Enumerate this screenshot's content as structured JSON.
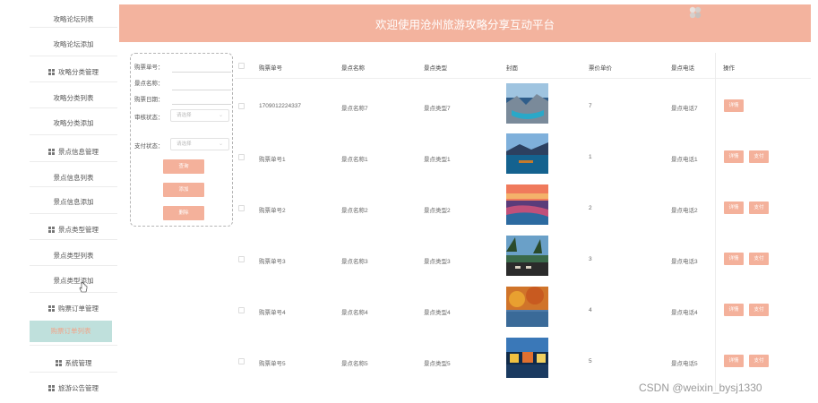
{
  "header": {
    "title": "欢迎使用沧州旅游攻略分享互动平台"
  },
  "sidebar": {
    "items": [
      {
        "label": "攻略论坛列表"
      },
      {
        "label": "攻略论坛添加"
      },
      {
        "label": "攻略分类管理"
      },
      {
        "label": "攻略分类列表"
      },
      {
        "label": "攻略分类添加"
      },
      {
        "label": "景点信息管理"
      },
      {
        "label": "景点信息列表"
      },
      {
        "label": "景点信息添加"
      },
      {
        "label": "景点类型管理"
      },
      {
        "label": "景点类型列表"
      },
      {
        "label": "景点类型添加"
      },
      {
        "label": "购票订单管理"
      },
      {
        "label": "购票订单列表"
      },
      {
        "label": "系统管理"
      },
      {
        "label": "旅游公告管理"
      }
    ]
  },
  "search": {
    "order_label": "购票单号：",
    "name_label": "景点名称：",
    "date_label": "购票日期：",
    "review_label": "审核状态：",
    "review_placeholder": "请选择",
    "pay_label": "支付状态：",
    "pay_placeholder": "请选择",
    "query_btn": "查询",
    "add_btn": "添加",
    "delete_btn": "删除"
  },
  "table": {
    "columns": [
      "购票单号",
      "景点名称",
      "景点类型",
      "封面",
      "票价单价",
      "景点电话",
      "操作"
    ],
    "detail_btn": "详情",
    "pay_btn": "支付",
    "rows": [
      {
        "order": "1709012224337",
        "name": "景点名称7",
        "type": "景点类型7",
        "price": "7",
        "phone": "景点电话7",
        "has_pay": false
      },
      {
        "order": "购票单号1",
        "name": "景点名称1",
        "type": "景点类型1",
        "price": "1",
        "phone": "景点电话1",
        "has_pay": true
      },
      {
        "order": "购票单号2",
        "name": "景点名称2",
        "type": "景点类型2",
        "price": "2",
        "phone": "景点电话2",
        "has_pay": true
      },
      {
        "order": "购票单号3",
        "name": "景点名称3",
        "type": "景点类型3",
        "price": "3",
        "phone": "景点电话3",
        "has_pay": true
      },
      {
        "order": "购票单号4",
        "name": "景点名称4",
        "type": "景点类型4",
        "price": "4",
        "phone": "景点电话4",
        "has_pay": true
      },
      {
        "order": "购票单号5",
        "name": "景点名称5",
        "type": "景点类型5",
        "price": "5",
        "phone": "景点电话5",
        "has_pay": true
      }
    ]
  },
  "watermark": "CSDN @weixin_bysj1330",
  "colors": {
    "accent": "#f3b39e",
    "button": "#f4b19b",
    "active_bg": "#bfe0dc",
    "active_text": "#f0a58a"
  }
}
